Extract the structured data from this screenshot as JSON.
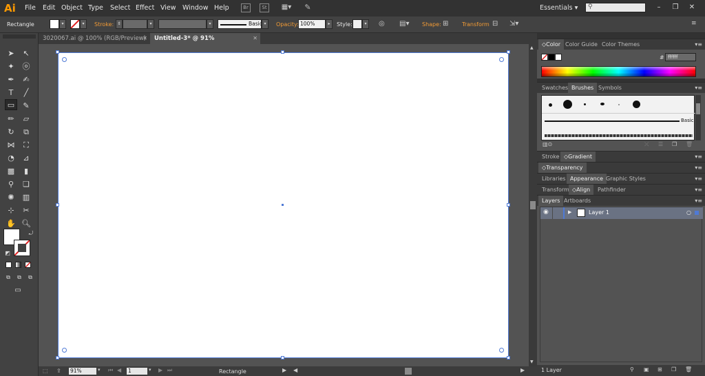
{
  "app": {
    "logo": "Ai",
    "workspace": "Essentials"
  },
  "menu": [
    "File",
    "Edit",
    "Object",
    "Type",
    "Select",
    "Effect",
    "View",
    "Window",
    "Help"
  ],
  "menubar_icons": [
    "Br",
    "St"
  ],
  "control": {
    "tool_name": "Rectangle",
    "stroke_label": "Stroke:",
    "brush_label": "Basic",
    "opacity_label": "Opacity:",
    "opacity_value": "100%",
    "style_label": "Style:",
    "shape_label": "Shape:",
    "transform_label": "Transform"
  },
  "tabs": [
    {
      "label": "3020067.ai @ 100% (RGB/Preview)",
      "active": false
    },
    {
      "label": "Untitled-3* @ 91% (RGB/Preview)",
      "active": true
    }
  ],
  "status": {
    "zoom": "91%",
    "artboard": "1",
    "tool": "Rectangle"
  },
  "panels": {
    "color_tabs": [
      "Color",
      "Color Guide",
      "Color Themes"
    ],
    "hex_label": "#",
    "hex_value": "ffffff",
    "brush_tabs": [
      "Swatches",
      "Brushes",
      "Symbols"
    ],
    "brush_name": "Basic",
    "stroke_tabs": [
      "Stroke",
      "Gradient"
    ],
    "transparency_tab": "Transparency",
    "appearance_tabs": [
      "Libraries",
      "Appearance",
      "Graphic Styles"
    ],
    "transform_tabs": [
      "Transform",
      "Align",
      "Pathfinder"
    ],
    "layers_tabs": [
      "Layers",
      "Artboards"
    ],
    "layer_name": "Layer 1",
    "layer_count": "1 Layer"
  },
  "colors": {
    "accent": "#f29b35",
    "selection": "#4f7ad6",
    "bg": "#535353"
  }
}
